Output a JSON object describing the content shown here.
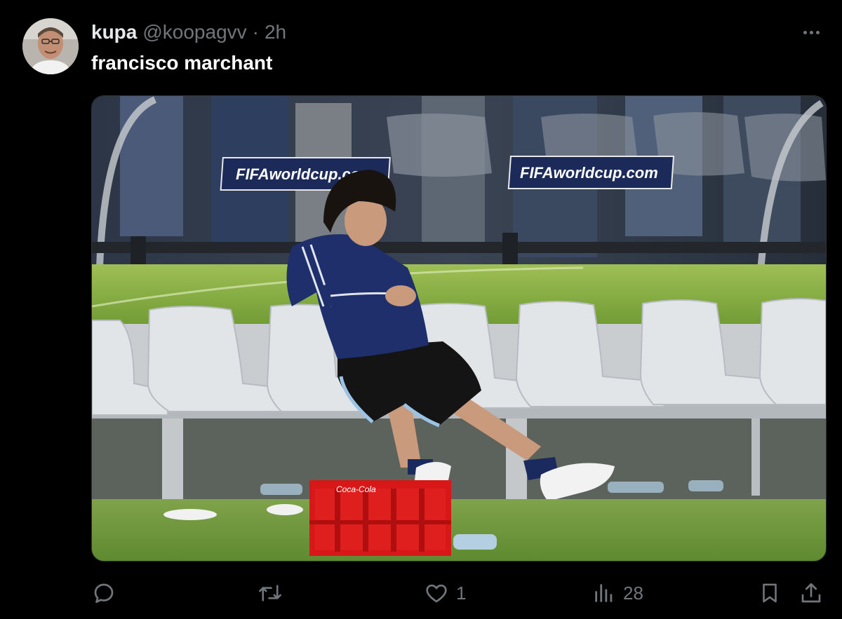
{
  "tweet": {
    "author": {
      "display_name": "kupa",
      "handle": "@koopagvv",
      "separator": "·",
      "time": "2h"
    },
    "text": "francisco marchant",
    "media": {
      "banners": [
        "FIFAworldcup.com",
        "FIFAworldcup.com"
      ],
      "crate_label": "Coca-Cola"
    },
    "stats": {
      "replies": "",
      "retweets": "",
      "likes": "1",
      "views": "28"
    }
  },
  "icons": {
    "reply": "reply-icon",
    "retweet": "retweet-icon",
    "like": "heart-icon",
    "views": "views-chart-icon",
    "bookmark": "bookmark-icon",
    "share": "share-icon",
    "more": "more-dots-icon"
  },
  "colors": {
    "background": "#000000",
    "primary_text": "#e7e9ea",
    "secondary_text": "#71767b",
    "border": "#2f3336"
  }
}
